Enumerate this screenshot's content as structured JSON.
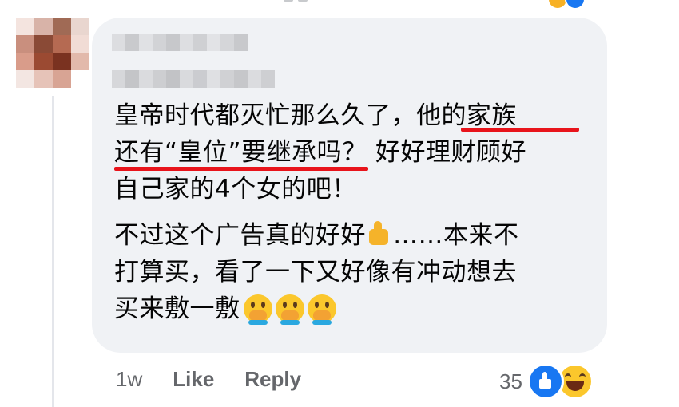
{
  "comment": {
    "paragraphs": [
      [
        "皇帝时代都灭忙那么久了，他的家族",
        "还有“皇位”要继承吗？ 好好理财顾好",
        "自己家的4个女的吧！"
      ],
      [
        "不过这个广告真的好好",
        "……本来不",
        "打算买，看了一下又好像有冲动想去",
        "买来敷一敷"
      ]
    ],
    "inline_icons": [
      "thumbs-up-icon",
      "face-with-hand-over-mouth-icon"
    ]
  },
  "meta": {
    "timestamp": "1w",
    "like_label": "Like",
    "reply_label": "Reply"
  },
  "reactions": {
    "count": "35",
    "icons": [
      "like-reaction-icon",
      "haha-reaction-icon"
    ]
  },
  "colors": {
    "bubble": "#f0f2f5",
    "underline": "#e8141b",
    "meta_text": "#65676b",
    "like_blue": "#1877f2"
  }
}
